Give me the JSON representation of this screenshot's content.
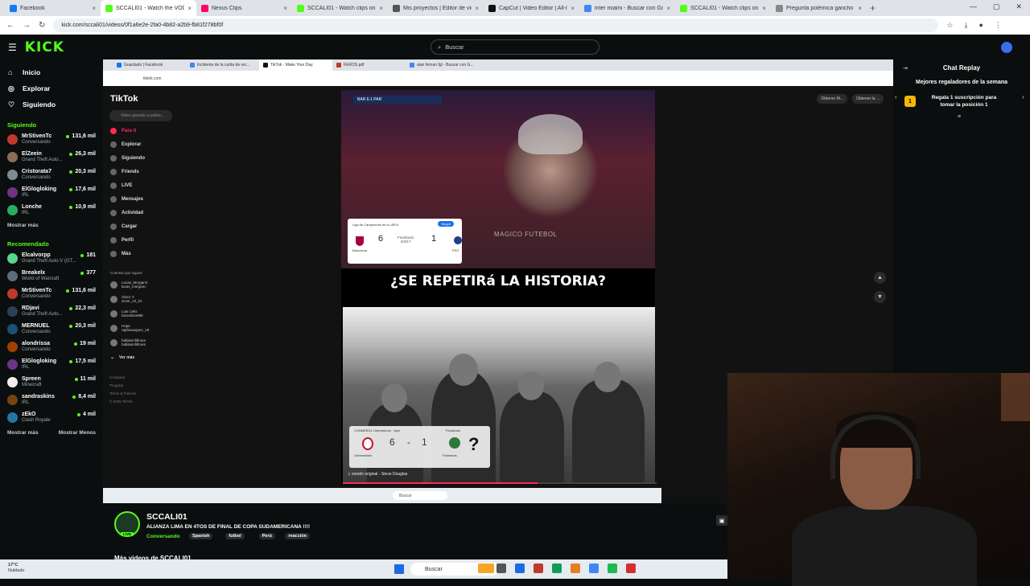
{
  "browser": {
    "tabs": [
      {
        "label": "Facebook",
        "color": "#1877f2",
        "active": false
      },
      {
        "label": "SCCALI01 - Watch the VOD",
        "color": "#53fc18",
        "active": true
      },
      {
        "label": "Nexus Clips",
        "color": "#f06",
        "active": false
      },
      {
        "label": "SCCALI01 - Watch clips on Kick",
        "color": "#53fc18",
        "active": false
      },
      {
        "label": "Mis proyectos | Editor de vídeo",
        "color": "#555",
        "active": false
      },
      {
        "label": "CapCut | Video Editor | All-In-O",
        "color": "#111",
        "active": false
      },
      {
        "label": "inter miami - Buscar con Google",
        "color": "#4285f4",
        "active": false
      },
      {
        "label": "SCCALI01 - Watch clips on Kick",
        "color": "#53fc18",
        "active": false
      },
      {
        "label": "Pregunta polémica gancho",
        "color": "#888",
        "active": false
      }
    ],
    "url": "kick.com/sccali01/videos/0f1a6e2e-2fa0-4b82-a2b9-fb81f278bf0f"
  },
  "kick": {
    "logo": "KICK",
    "search_placeholder": "Buscar",
    "nav": [
      {
        "icon": "home-icon",
        "glyph": "⌂",
        "label": "Inicio"
      },
      {
        "icon": "compass-icon",
        "glyph": "◎",
        "label": "Explorar"
      },
      {
        "icon": "heart-icon",
        "glyph": "♡",
        "label": "Siguiendo"
      }
    ],
    "following_header": "Siguiendo",
    "following": [
      {
        "name": "MrStivenTc",
        "category": "Conversando",
        "viewers": "131,6 mil",
        "color": "#c0392b"
      },
      {
        "name": "ElZeein",
        "category": "Grand Theft Auto...",
        "viewers": "26,3 mil",
        "color": "#8e6e53"
      },
      {
        "name": "Cristorata7",
        "category": "Conversando",
        "viewers": "20,3 mil",
        "color": "#7f8c8d"
      },
      {
        "name": "ElGlogloking",
        "category": "IRL",
        "viewers": "17,6 mil",
        "color": "#6c3483"
      },
      {
        "name": "Lonche",
        "category": "IRL",
        "viewers": "10,9 mil",
        "color": "#27ae60"
      }
    ],
    "show_more": "Mostrar más",
    "recommended_header": "Recomendado",
    "recommended": [
      {
        "name": "Elcalvorpp",
        "category": "Grand Theft Auto V (GT...",
        "viewers": "181",
        "color": "#58d68d"
      },
      {
        "name": "Breakelx",
        "category": "World of Warcraft",
        "viewers": "377",
        "color": "#5d6d7e"
      },
      {
        "name": "MrStivenTc",
        "category": "Conversando",
        "viewers": "131,6 mil",
        "color": "#c0392b"
      },
      {
        "name": "RDjavi",
        "category": "Grand Theft Auto...",
        "viewers": "22,3 mil",
        "color": "#2e4053"
      },
      {
        "name": "MERNUEL",
        "category": "Conversando",
        "viewers": "20,3 mil",
        "color": "#1a5276"
      },
      {
        "name": "alondrissa",
        "category": "Conversando",
        "viewers": "19 mil",
        "color": "#a04000"
      },
      {
        "name": "ElGlogloking",
        "category": "IRL",
        "viewers": "17,5 mil",
        "color": "#6c3483"
      },
      {
        "name": "Spreen",
        "category": "Minecraft",
        "viewers": "11 mil",
        "color": "#eeeeee"
      },
      {
        "name": "sandraskins",
        "category": "IRL",
        "viewers": "8,4 mil",
        "color": "#784212"
      },
      {
        "name": "zEkO",
        "category": "Clash Royale",
        "viewers": "4 mil",
        "color": "#2874a6"
      }
    ],
    "show_more2": "Mostrar más",
    "show_less": "Mostrar Menos"
  },
  "inner_browser": {
    "tabs": [
      {
        "label": "Guardado | Facebook",
        "color": "#1877f2",
        "active": false
      },
      {
        "label": "Incidente de la caída de rec...",
        "color": "#4285f4",
        "active": false
      },
      {
        "label": "TikTok - Make Your Day",
        "color": "#111",
        "active": true
      },
      {
        "label": "FEROS.pdf",
        "color": "#c0392b",
        "active": false
      },
      {
        "label": "alan fernan fgl - Buscar con G...",
        "color": "#4285f4",
        "active": false
      }
    ],
    "url": "tiktok.com"
  },
  "tiktok": {
    "logo": "TikTok",
    "search_placeholder": "Video ganado a palme...",
    "nav": [
      {
        "label": "Para ti",
        "red": true
      },
      {
        "label": "Explorar",
        "red": false
      },
      {
        "label": "Siguiendo",
        "red": false
      },
      {
        "label": "Friends",
        "red": false
      },
      {
        "label": "LIVE",
        "red": false
      },
      {
        "label": "Mensajes",
        "red": false
      },
      {
        "label": "Actividad",
        "red": false
      },
      {
        "label": "Cargar",
        "red": false
      },
      {
        "label": "Perfil",
        "red": false
      },
      {
        "label": "Más",
        "red": false
      }
    ],
    "following_accounts_header": "Cuentas que sigues",
    "accounts": [
      {
        "name": "Lucas_MorganC",
        "handle": "lucas_morganc"
      },
      {
        "name": "Victor Y.",
        "handle": "victor_10_01"
      },
      {
        "name": "Luis Celis",
        "handle": "luisceliscel99"
      },
      {
        "name": "Hope",
        "handle": "raphivasquez_18"
      },
      {
        "name": "hablasinfiltroes",
        "handle": "hablasinfiltroes"
      }
    ],
    "see_more": "Ver más",
    "footer": [
      "Company",
      "Program",
      "Terms & Policies",
      "© 2025 TikTok"
    ],
    "get_app": [
      "Obtener M...",
      "Obtener la ..."
    ],
    "video": {
      "scorebug": "BAR 6-1 PAR",
      "card1": {
        "competition": "Liga de Campeones de la UEFA",
        "follow": "Seguir",
        "home_score": "6",
        "away_score": "1",
        "status": "Finalizado",
        "date": "8/3/17",
        "home_team": "Barcelona",
        "away_team": "PSG"
      },
      "watermark": "MAGICO FUTEBOL",
      "headline": "¿SE REPETIRá LA HISTORIA?",
      "card2": {
        "competition": "CONMEBOL Libertadores · Ayer",
        "home_score": "6",
        "separator": "-",
        "away_score": "1",
        "status": "Finalizado",
        "home_team": "Universitario",
        "away_team": "Palmeiras",
        "question": "?"
      },
      "sound": "♫ sonido original - Steve Douglas",
      "progress": 0.62
    }
  },
  "stream": {
    "name": "SCCALI01",
    "live": "LIVE",
    "title": "ALIANZA LIMA EN 4TOS DE FINAL DE COPA SUDAMERICANA !!!!",
    "category": "Conversando",
    "tags": [
      "Spanish",
      "futbol",
      "Perú",
      "reacción"
    ],
    "more_videos": "Más videos de SCCALI01"
  },
  "chat": {
    "title": "Chat Replay",
    "subtitle": "Mejores regaladores de la semana",
    "gift_rank": "1",
    "gift_text": "Regala 1 suscripción para tomar la posición 1"
  },
  "taskbar": {
    "temperature": "17°C",
    "weather": "Nublado",
    "search": "Buscar",
    "icons": [
      "#f5a623",
      "#555",
      "#1d6ae5",
      "#c0392b",
      "#0f9d58",
      "#e67e22",
      "#4285f4",
      "#1db954",
      "#d32f2f"
    ]
  }
}
